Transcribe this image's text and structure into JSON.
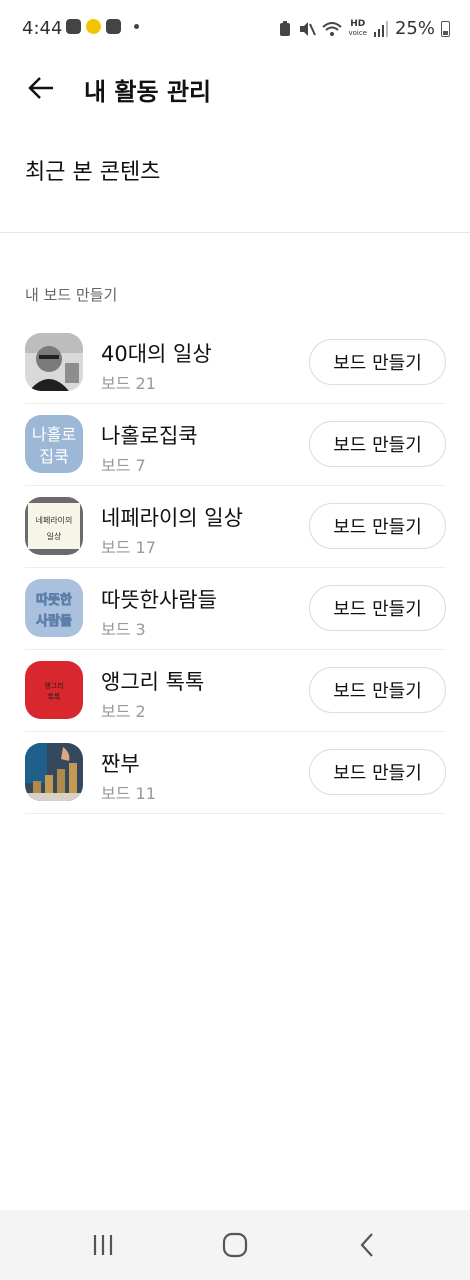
{
  "status_bar": {
    "time": "4:44",
    "hd_label": "HD",
    "hd_sub": "voice",
    "battery_percent": "25%"
  },
  "header": {
    "title": "내 활동 관리",
    "back_icon": "back-arrow-icon"
  },
  "recent": {
    "label": "최근 본 콘텐츠"
  },
  "board_section": {
    "heading": "내 보드 만들기",
    "button_label": "보드 만들기",
    "items": [
      {
        "name": "40대의 일상",
        "count": "보드 21"
      },
      {
        "name": "나홀로집쿡",
        "count": "보드 7",
        "thumb_text_1": "나홀로",
        "thumb_text_2": "집쿡"
      },
      {
        "name": "네페라이의 일상",
        "count": "보드 17",
        "thumb_text_1": "네페라이의",
        "thumb_text_2": "일상"
      },
      {
        "name": "따뜻한사람들",
        "count": "보드 3",
        "thumb_text_1": "따뜻한",
        "thumb_text_2": "사람들"
      },
      {
        "name": "앵그리 톡톡",
        "count": "보드 2",
        "thumb_text_1": "앵그리",
        "thumb_text_2": "톡톡"
      },
      {
        "name": "짠부",
        "count": "보드 11"
      }
    ]
  },
  "nav": {
    "recent_apps_icon": "recent-apps-icon",
    "home_icon": "home-icon",
    "back_icon": "nav-back-icon"
  },
  "colors": {
    "divider": "#e6e6e6",
    "muted_text": "#999999",
    "nav_background": "#f4f4f4"
  }
}
